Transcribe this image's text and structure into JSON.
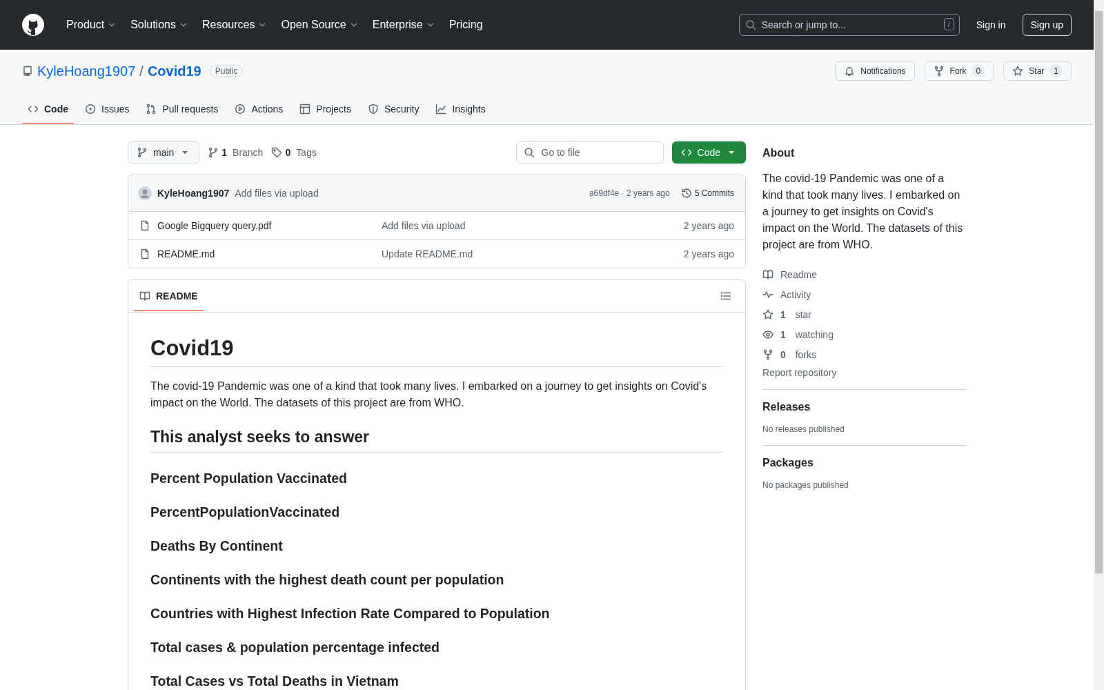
{
  "header": {
    "nav": [
      {
        "label": "Product",
        "dropdown": true
      },
      {
        "label": "Solutions",
        "dropdown": true
      },
      {
        "label": "Resources",
        "dropdown": true
      },
      {
        "label": "Open Source",
        "dropdown": true
      },
      {
        "label": "Enterprise",
        "dropdown": true
      },
      {
        "label": "Pricing",
        "dropdown": false
      }
    ],
    "search": {
      "placeholder": "Search or jump to...",
      "shortcut": "/"
    },
    "sign_in": "Sign in",
    "sign_up": "Sign up"
  },
  "repo": {
    "owner": "KyleHoang1907",
    "separator": "/",
    "name": "Covid19",
    "visibility": "Public",
    "actions": [
      {
        "label": "Notifications"
      },
      {
        "label": "Fork",
        "count": "0"
      },
      {
        "label": "Star",
        "count": "1"
      }
    ],
    "tabs": [
      {
        "label": "Code",
        "selected": true
      },
      {
        "label": "Issues",
        "selected": false
      },
      {
        "label": "Pull requests",
        "selected": false
      },
      {
        "label": "Actions",
        "selected": false
      },
      {
        "label": "Projects",
        "selected": false
      },
      {
        "label": "Security",
        "selected": false
      },
      {
        "label": "Insights",
        "selected": false
      }
    ]
  },
  "toolbar": {
    "branch": "main",
    "branches": {
      "count": "1",
      "label": "Branch"
    },
    "tags": {
      "count": "0",
      "label": "Tags"
    },
    "go_to_file": {
      "placeholder": "Go to file"
    },
    "code_button": "Code"
  },
  "latest_commit": {
    "author": "KyleHoang1907",
    "message": "Add files via upload",
    "hash": "a69df4e · 2 years ago",
    "commits": "5 Commits"
  },
  "files": [
    {
      "name": "Google Bigquery query.pdf",
      "message": "Add files via upload",
      "age": "2 years ago"
    },
    {
      "name": "README.md",
      "message": "Update README.md",
      "age": "2 years ago"
    }
  ],
  "readme": {
    "tab": {
      "label": "README",
      "selected": true
    },
    "title": "Covid19",
    "intro": "The covid-19 Pandemic was one of a kind that took many lives. I embarked on a journey to get insights on Covid's impact on the World. The datasets of this project are from WHO.",
    "section": "This analyst seeks to answer",
    "questions": [
      "Percent Population Vaccinated",
      "PercentPopulationVaccinated",
      "Deaths By Continent",
      "Continents with the highest death count per population",
      "Countries with Highest Infection Rate Compared to Population",
      "Total cases & population percentage infected",
      "Total Cases vs Total Deaths in Vietnam"
    ]
  },
  "about": {
    "title": "About",
    "description": "The covid-19 Pandemic was one of a kind that took many lives. I embarked on a journey to get insights on Covid's impact on the World. The datasets of this project are from WHO.",
    "links": [
      {
        "kind": "readme",
        "label": "Readme"
      },
      {
        "kind": "activity",
        "label": "Activity"
      },
      {
        "kind": "star",
        "count": "1",
        "label": "star"
      },
      {
        "kind": "watch",
        "count": "1",
        "label": "watching"
      },
      {
        "kind": "fork",
        "count": "0",
        "label": "forks"
      }
    ],
    "report": "Report repository"
  },
  "releases": {
    "title": "Releases",
    "note": "No releases published"
  },
  "packages": {
    "title": "Packages",
    "note": "No packages published"
  }
}
